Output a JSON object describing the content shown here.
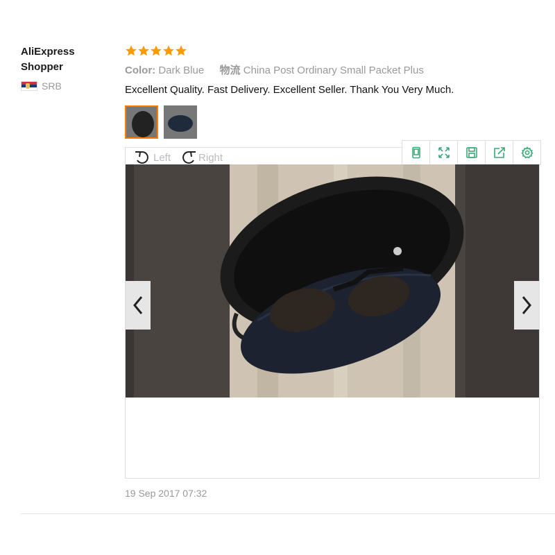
{
  "reviewer": {
    "name": "AliExpress Shopper",
    "country_code": "SRB"
  },
  "review": {
    "rating": 5,
    "rating_max": 5,
    "color_label": "Color:",
    "color_value": "Dark Blue",
    "shipping_label": "物流",
    "shipping_value": "China Post Ordinary Small Packet Plus",
    "text": "Excellent Quality. Fast Delivery. Excellent Seller. Thank You Very Much.",
    "date": "19 Sep 2017 07:32"
  },
  "thumbnails": [
    {
      "name": "photo-1",
      "active": true
    },
    {
      "name": "photo-2",
      "active": false
    }
  ],
  "viewer": {
    "rotate_left_label": "Left",
    "rotate_right_label": "Right",
    "toolbar_icons": [
      "phone-icon",
      "fullscreen-icon",
      "save-icon",
      "share-icon",
      "settings-icon"
    ],
    "accent_color": "#3aa876"
  },
  "colors": {
    "star": "#ff9a00",
    "active_thumb_border": "#ff7a00",
    "muted_text": "#999999"
  }
}
